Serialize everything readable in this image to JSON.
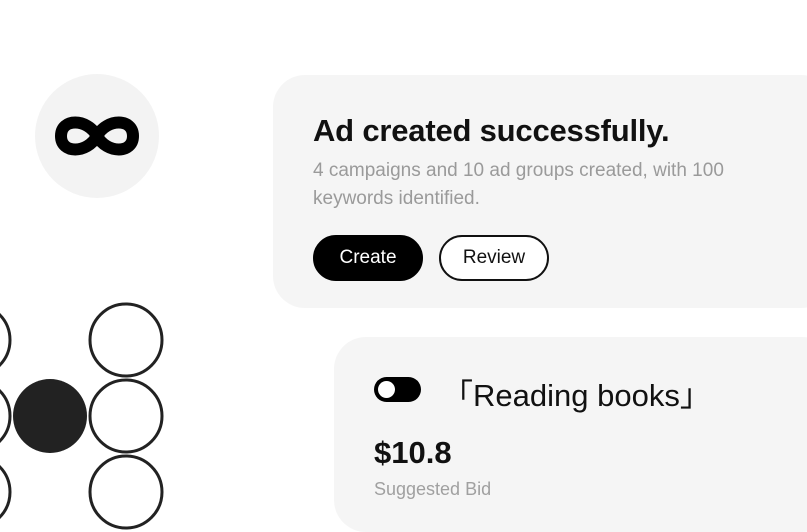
{
  "logo": {
    "icon": "infinity-icon"
  },
  "success_card": {
    "title": "Ad created successfully.",
    "description": "4 campaigns and 10 ad groups created, with 100 keywords identified.",
    "create_label": "Create",
    "review_label": "Review"
  },
  "keyword_card": {
    "toggle_on": false,
    "keyword": "「Reading books」",
    "bid": "$10.8",
    "bid_label": "Suggested Bid"
  },
  "colors": {
    "card_background": "#f5f5f5",
    "primary": "#000000",
    "muted_text": "#9a9a9a"
  }
}
